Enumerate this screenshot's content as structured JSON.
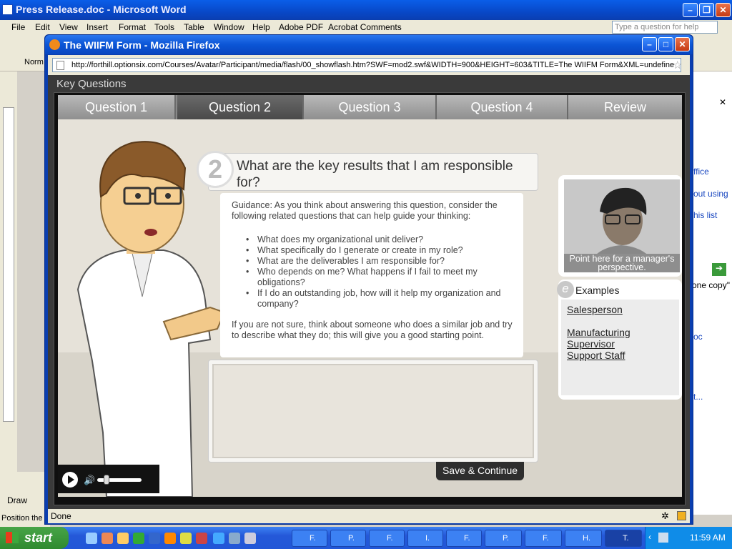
{
  "word": {
    "title": "Press Release.doc - Microsoft Word",
    "menu": [
      "File",
      "Edit",
      "View",
      "Insert",
      "Format",
      "Tools",
      "Table",
      "Window",
      "Help",
      "Adobe PDF",
      "Acrobat Comments"
    ],
    "ask_placeholder": "Type a question for help",
    "style_box": "Norm",
    "draw_label": "Draw",
    "position_label": "Position the",
    "pane_texts": [
      "ffice",
      "out using",
      "his list",
      "one copy\"",
      "oc",
      "t..."
    ]
  },
  "firefox": {
    "title": "The WIIFM Form - Mozilla Firefox",
    "url": "http://forthill.optionsix.com/Courses/Avatar/Participant/media/flash/00_showflash.htm?SWF=mod2.swf&WIDTH=900&HEIGHT=603&TITLE=The WIIFM Form&XML=undefine",
    "status": "Done"
  },
  "flash": {
    "header": "Key Questions",
    "tabs": [
      "Question 1",
      "Question 2",
      "Question 3",
      "Question 4",
      "Review"
    ],
    "active_tab": 1,
    "question": {
      "number": "2",
      "text": "What are the key results that I am responsible for?"
    },
    "guidance_intro": "Guidance: As you think about answering this question, consider the following related questions that can help guide your thinking:",
    "bullets": [
      "What does my organizational unit deliver?",
      "What specifically do I generate or create in my role?",
      "What are the deliverables I am responsible for?",
      "Who depends on me? What happens if I fail to meet my obligations?",
      "If I do an outstanding job, how will it help my organization and company?"
    ],
    "guidance_outro": "If you are not sure, think about someone who does a similar job and try to describe what they do; this will give you a good starting point.",
    "save_button": "Save  & Continue",
    "manager_label": "Point here for a manager's perspective.",
    "examples_title": "Examples",
    "examples_badge": "e",
    "examples": [
      "Salesperson",
      "Manufacturing Supervisor",
      "Support Staff"
    ]
  },
  "taskbar": {
    "start": "start",
    "items": [
      "F.",
      "P.",
      "F.",
      "I.",
      "F.",
      "P.",
      "F.",
      "H.",
      "T."
    ],
    "clock": "11:59 AM"
  }
}
